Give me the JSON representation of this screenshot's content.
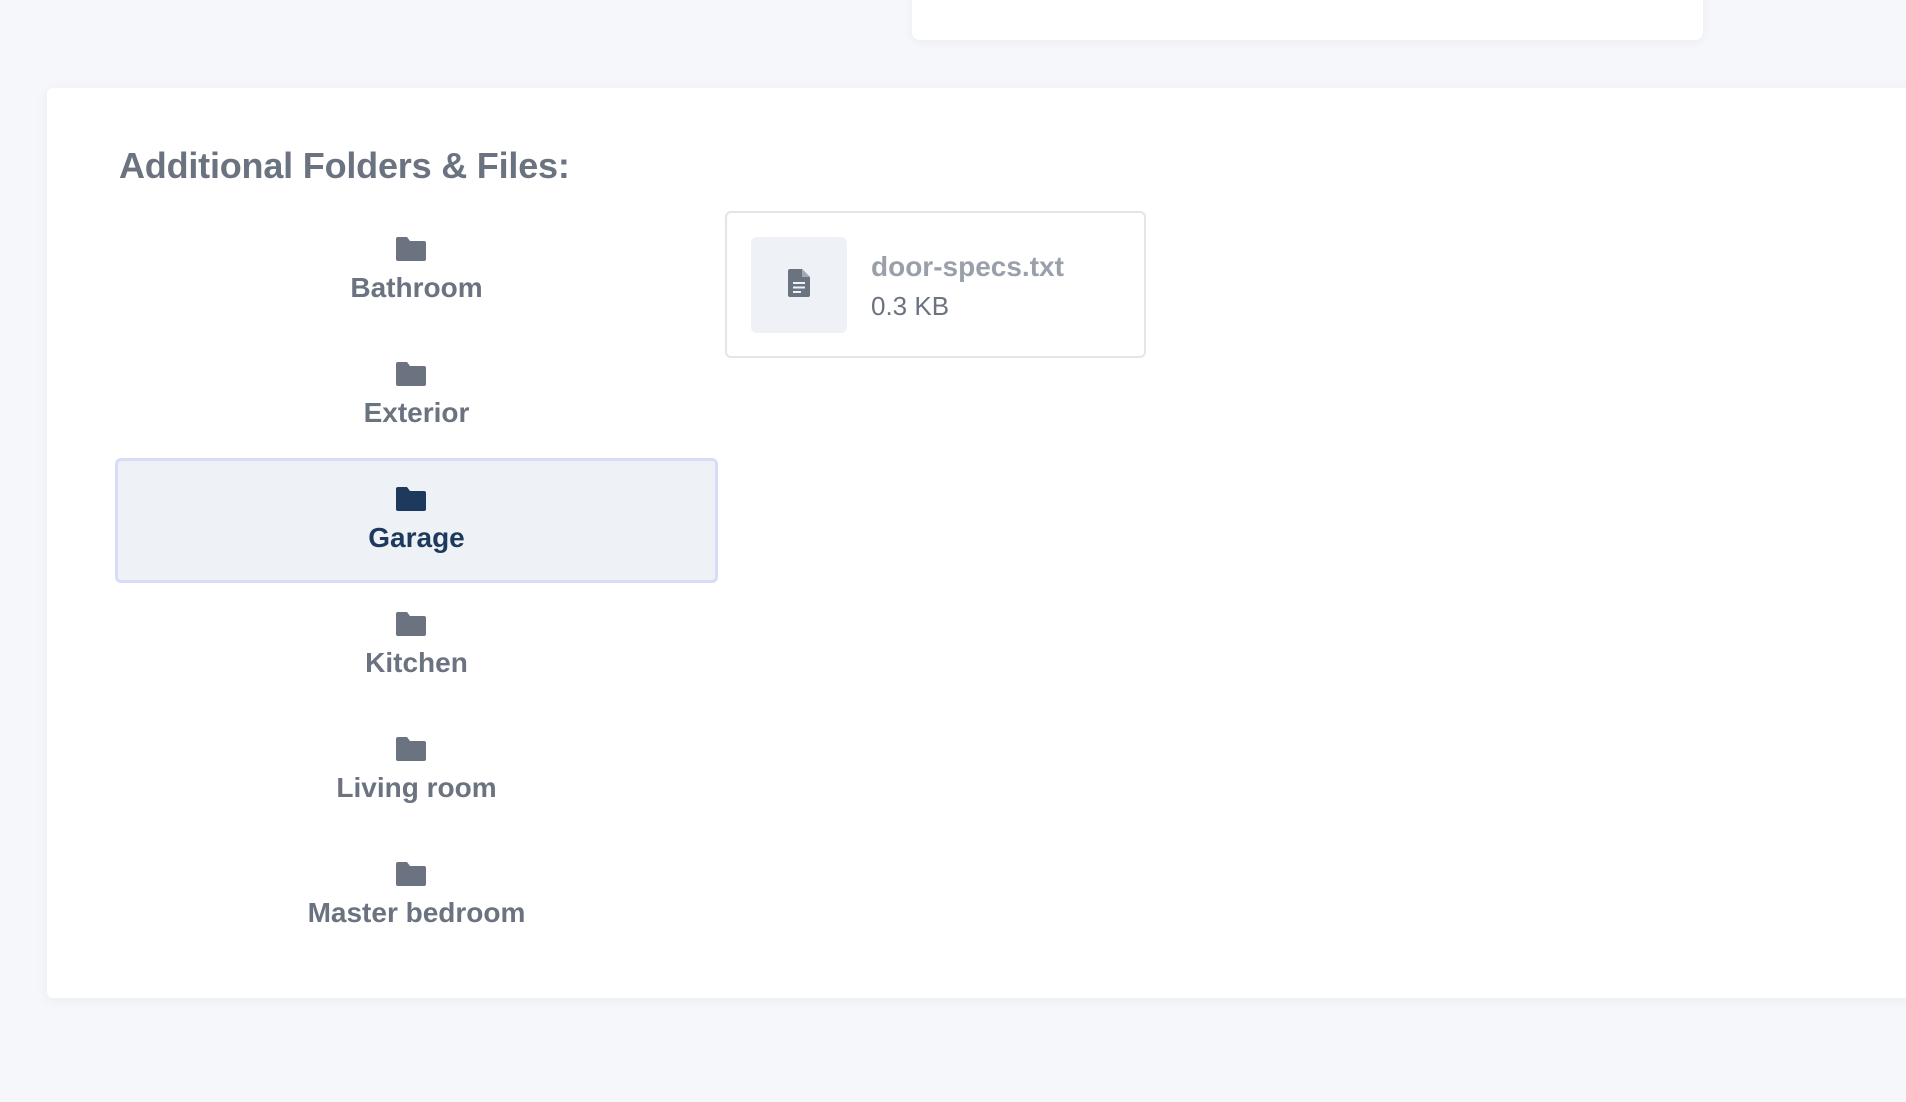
{
  "section": {
    "title": "Additional Folders & Files:"
  },
  "folders": [
    {
      "label": "Bathroom",
      "icon": "folder-icon",
      "selected": false
    },
    {
      "label": "Exterior",
      "icon": "folder-icon",
      "selected": false
    },
    {
      "label": "Garage",
      "icon": "folder-icon",
      "selected": true
    },
    {
      "label": "Kitchen",
      "icon": "folder-icon",
      "selected": false
    },
    {
      "label": "Living room",
      "icon": "folder-icon",
      "selected": false
    },
    {
      "label": "Master bedroom",
      "icon": "folder-icon",
      "selected": false
    }
  ],
  "files": [
    {
      "name": "door-specs.txt",
      "size": "0.3 KB",
      "icon": "document-icon"
    }
  ],
  "colors": {
    "folder_icon": "#6b7380",
    "folder_icon_selected": "#1d3a5c",
    "selected_bg": "#eef2f7",
    "selected_border": "#d8dcf6",
    "text_muted": "#6b7380",
    "file_name": "#9aa0a9"
  }
}
